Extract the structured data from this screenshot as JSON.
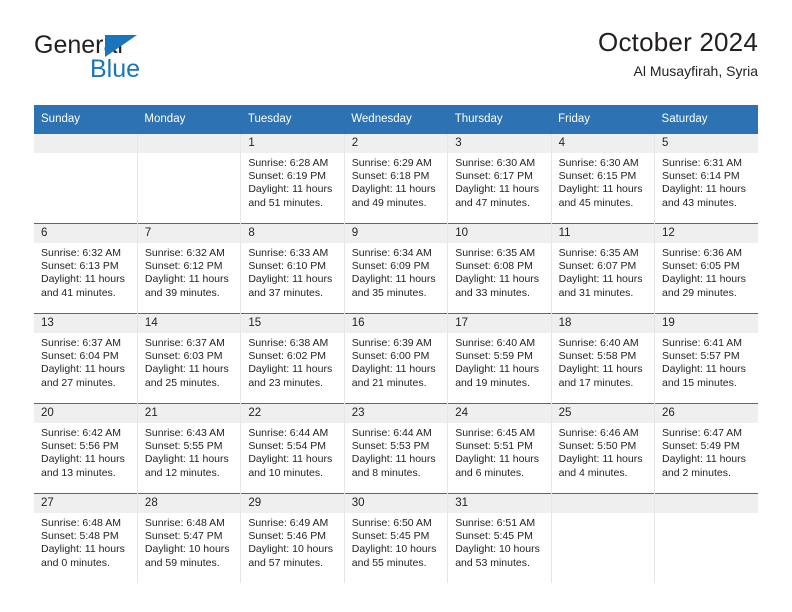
{
  "brand": {
    "name_part1": "General",
    "name_part2": "Blue",
    "flag_icon": "blue-triangle-flag",
    "accent_color": "#1b75bb"
  },
  "header": {
    "title": "October 2024",
    "subtitle": "Al Musayfirah, Syria"
  },
  "theme": {
    "header_blue": "#2d72b2",
    "daynum_band": "#efefef",
    "text": "#231f20"
  },
  "calendar": {
    "weekday_headers": [
      "Sunday",
      "Monday",
      "Tuesday",
      "Wednesday",
      "Thursday",
      "Friday",
      "Saturday"
    ],
    "labels": {
      "sunrise": "Sunrise:",
      "sunset": "Sunset:",
      "daylight": "Daylight:"
    },
    "weeks": [
      [
        {
          "day": "",
          "empty": true
        },
        {
          "day": "",
          "empty": true
        },
        {
          "day": "1",
          "sunrise": "Sunrise: 6:28 AM",
          "sunset": "Sunset: 6:19 PM",
          "daylight_l1": "Daylight: 11 hours",
          "daylight_l2": "and 51 minutes."
        },
        {
          "day": "2",
          "sunrise": "Sunrise: 6:29 AM",
          "sunset": "Sunset: 6:18 PM",
          "daylight_l1": "Daylight: 11 hours",
          "daylight_l2": "and 49 minutes."
        },
        {
          "day": "3",
          "sunrise": "Sunrise: 6:30 AM",
          "sunset": "Sunset: 6:17 PM",
          "daylight_l1": "Daylight: 11 hours",
          "daylight_l2": "and 47 minutes."
        },
        {
          "day": "4",
          "sunrise": "Sunrise: 6:30 AM",
          "sunset": "Sunset: 6:15 PM",
          "daylight_l1": "Daylight: 11 hours",
          "daylight_l2": "and 45 minutes."
        },
        {
          "day": "5",
          "sunrise": "Sunrise: 6:31 AM",
          "sunset": "Sunset: 6:14 PM",
          "daylight_l1": "Daylight: 11 hours",
          "daylight_l2": "and 43 minutes."
        }
      ],
      [
        {
          "day": "6",
          "sunrise": "Sunrise: 6:32 AM",
          "sunset": "Sunset: 6:13 PM",
          "daylight_l1": "Daylight: 11 hours",
          "daylight_l2": "and 41 minutes."
        },
        {
          "day": "7",
          "sunrise": "Sunrise: 6:32 AM",
          "sunset": "Sunset: 6:12 PM",
          "daylight_l1": "Daylight: 11 hours",
          "daylight_l2": "and 39 minutes."
        },
        {
          "day": "8",
          "sunrise": "Sunrise: 6:33 AM",
          "sunset": "Sunset: 6:10 PM",
          "daylight_l1": "Daylight: 11 hours",
          "daylight_l2": "and 37 minutes."
        },
        {
          "day": "9",
          "sunrise": "Sunrise: 6:34 AM",
          "sunset": "Sunset: 6:09 PM",
          "daylight_l1": "Daylight: 11 hours",
          "daylight_l2": "and 35 minutes."
        },
        {
          "day": "10",
          "sunrise": "Sunrise: 6:35 AM",
          "sunset": "Sunset: 6:08 PM",
          "daylight_l1": "Daylight: 11 hours",
          "daylight_l2": "and 33 minutes."
        },
        {
          "day": "11",
          "sunrise": "Sunrise: 6:35 AM",
          "sunset": "Sunset: 6:07 PM",
          "daylight_l1": "Daylight: 11 hours",
          "daylight_l2": "and 31 minutes."
        },
        {
          "day": "12",
          "sunrise": "Sunrise: 6:36 AM",
          "sunset": "Sunset: 6:05 PM",
          "daylight_l1": "Daylight: 11 hours",
          "daylight_l2": "and 29 minutes."
        }
      ],
      [
        {
          "day": "13",
          "sunrise": "Sunrise: 6:37 AM",
          "sunset": "Sunset: 6:04 PM",
          "daylight_l1": "Daylight: 11 hours",
          "daylight_l2": "and 27 minutes."
        },
        {
          "day": "14",
          "sunrise": "Sunrise: 6:37 AM",
          "sunset": "Sunset: 6:03 PM",
          "daylight_l1": "Daylight: 11 hours",
          "daylight_l2": "and 25 minutes."
        },
        {
          "day": "15",
          "sunrise": "Sunrise: 6:38 AM",
          "sunset": "Sunset: 6:02 PM",
          "daylight_l1": "Daylight: 11 hours",
          "daylight_l2": "and 23 minutes."
        },
        {
          "day": "16",
          "sunrise": "Sunrise: 6:39 AM",
          "sunset": "Sunset: 6:00 PM",
          "daylight_l1": "Daylight: 11 hours",
          "daylight_l2": "and 21 minutes."
        },
        {
          "day": "17",
          "sunrise": "Sunrise: 6:40 AM",
          "sunset": "Sunset: 5:59 PM",
          "daylight_l1": "Daylight: 11 hours",
          "daylight_l2": "and 19 minutes."
        },
        {
          "day": "18",
          "sunrise": "Sunrise: 6:40 AM",
          "sunset": "Sunset: 5:58 PM",
          "daylight_l1": "Daylight: 11 hours",
          "daylight_l2": "and 17 minutes."
        },
        {
          "day": "19",
          "sunrise": "Sunrise: 6:41 AM",
          "sunset": "Sunset: 5:57 PM",
          "daylight_l1": "Daylight: 11 hours",
          "daylight_l2": "and 15 minutes."
        }
      ],
      [
        {
          "day": "20",
          "sunrise": "Sunrise: 6:42 AM",
          "sunset": "Sunset: 5:56 PM",
          "daylight_l1": "Daylight: 11 hours",
          "daylight_l2": "and 13 minutes."
        },
        {
          "day": "21",
          "sunrise": "Sunrise: 6:43 AM",
          "sunset": "Sunset: 5:55 PM",
          "daylight_l1": "Daylight: 11 hours",
          "daylight_l2": "and 12 minutes."
        },
        {
          "day": "22",
          "sunrise": "Sunrise: 6:44 AM",
          "sunset": "Sunset: 5:54 PM",
          "daylight_l1": "Daylight: 11 hours",
          "daylight_l2": "and 10 minutes."
        },
        {
          "day": "23",
          "sunrise": "Sunrise: 6:44 AM",
          "sunset": "Sunset: 5:53 PM",
          "daylight_l1": "Daylight: 11 hours",
          "daylight_l2": "and 8 minutes."
        },
        {
          "day": "24",
          "sunrise": "Sunrise: 6:45 AM",
          "sunset": "Sunset: 5:51 PM",
          "daylight_l1": "Daylight: 11 hours",
          "daylight_l2": "and 6 minutes."
        },
        {
          "day": "25",
          "sunrise": "Sunrise: 6:46 AM",
          "sunset": "Sunset: 5:50 PM",
          "daylight_l1": "Daylight: 11 hours",
          "daylight_l2": "and 4 minutes."
        },
        {
          "day": "26",
          "sunrise": "Sunrise: 6:47 AM",
          "sunset": "Sunset: 5:49 PM",
          "daylight_l1": "Daylight: 11 hours",
          "daylight_l2": "and 2 minutes."
        }
      ],
      [
        {
          "day": "27",
          "sunrise": "Sunrise: 6:48 AM",
          "sunset": "Sunset: 5:48 PM",
          "daylight_l1": "Daylight: 11 hours",
          "daylight_l2": "and 0 minutes."
        },
        {
          "day": "28",
          "sunrise": "Sunrise: 6:48 AM",
          "sunset": "Sunset: 5:47 PM",
          "daylight_l1": "Daylight: 10 hours",
          "daylight_l2": "and 59 minutes."
        },
        {
          "day": "29",
          "sunrise": "Sunrise: 6:49 AM",
          "sunset": "Sunset: 5:46 PM",
          "daylight_l1": "Daylight: 10 hours",
          "daylight_l2": "and 57 minutes."
        },
        {
          "day": "30",
          "sunrise": "Sunrise: 6:50 AM",
          "sunset": "Sunset: 5:45 PM",
          "daylight_l1": "Daylight: 10 hours",
          "daylight_l2": "and 55 minutes."
        },
        {
          "day": "31",
          "sunrise": "Sunrise: 6:51 AM",
          "sunset": "Sunset: 5:45 PM",
          "daylight_l1": "Daylight: 10 hours",
          "daylight_l2": "and 53 minutes."
        },
        {
          "day": "",
          "empty": true
        },
        {
          "day": "",
          "empty": true
        }
      ]
    ]
  }
}
